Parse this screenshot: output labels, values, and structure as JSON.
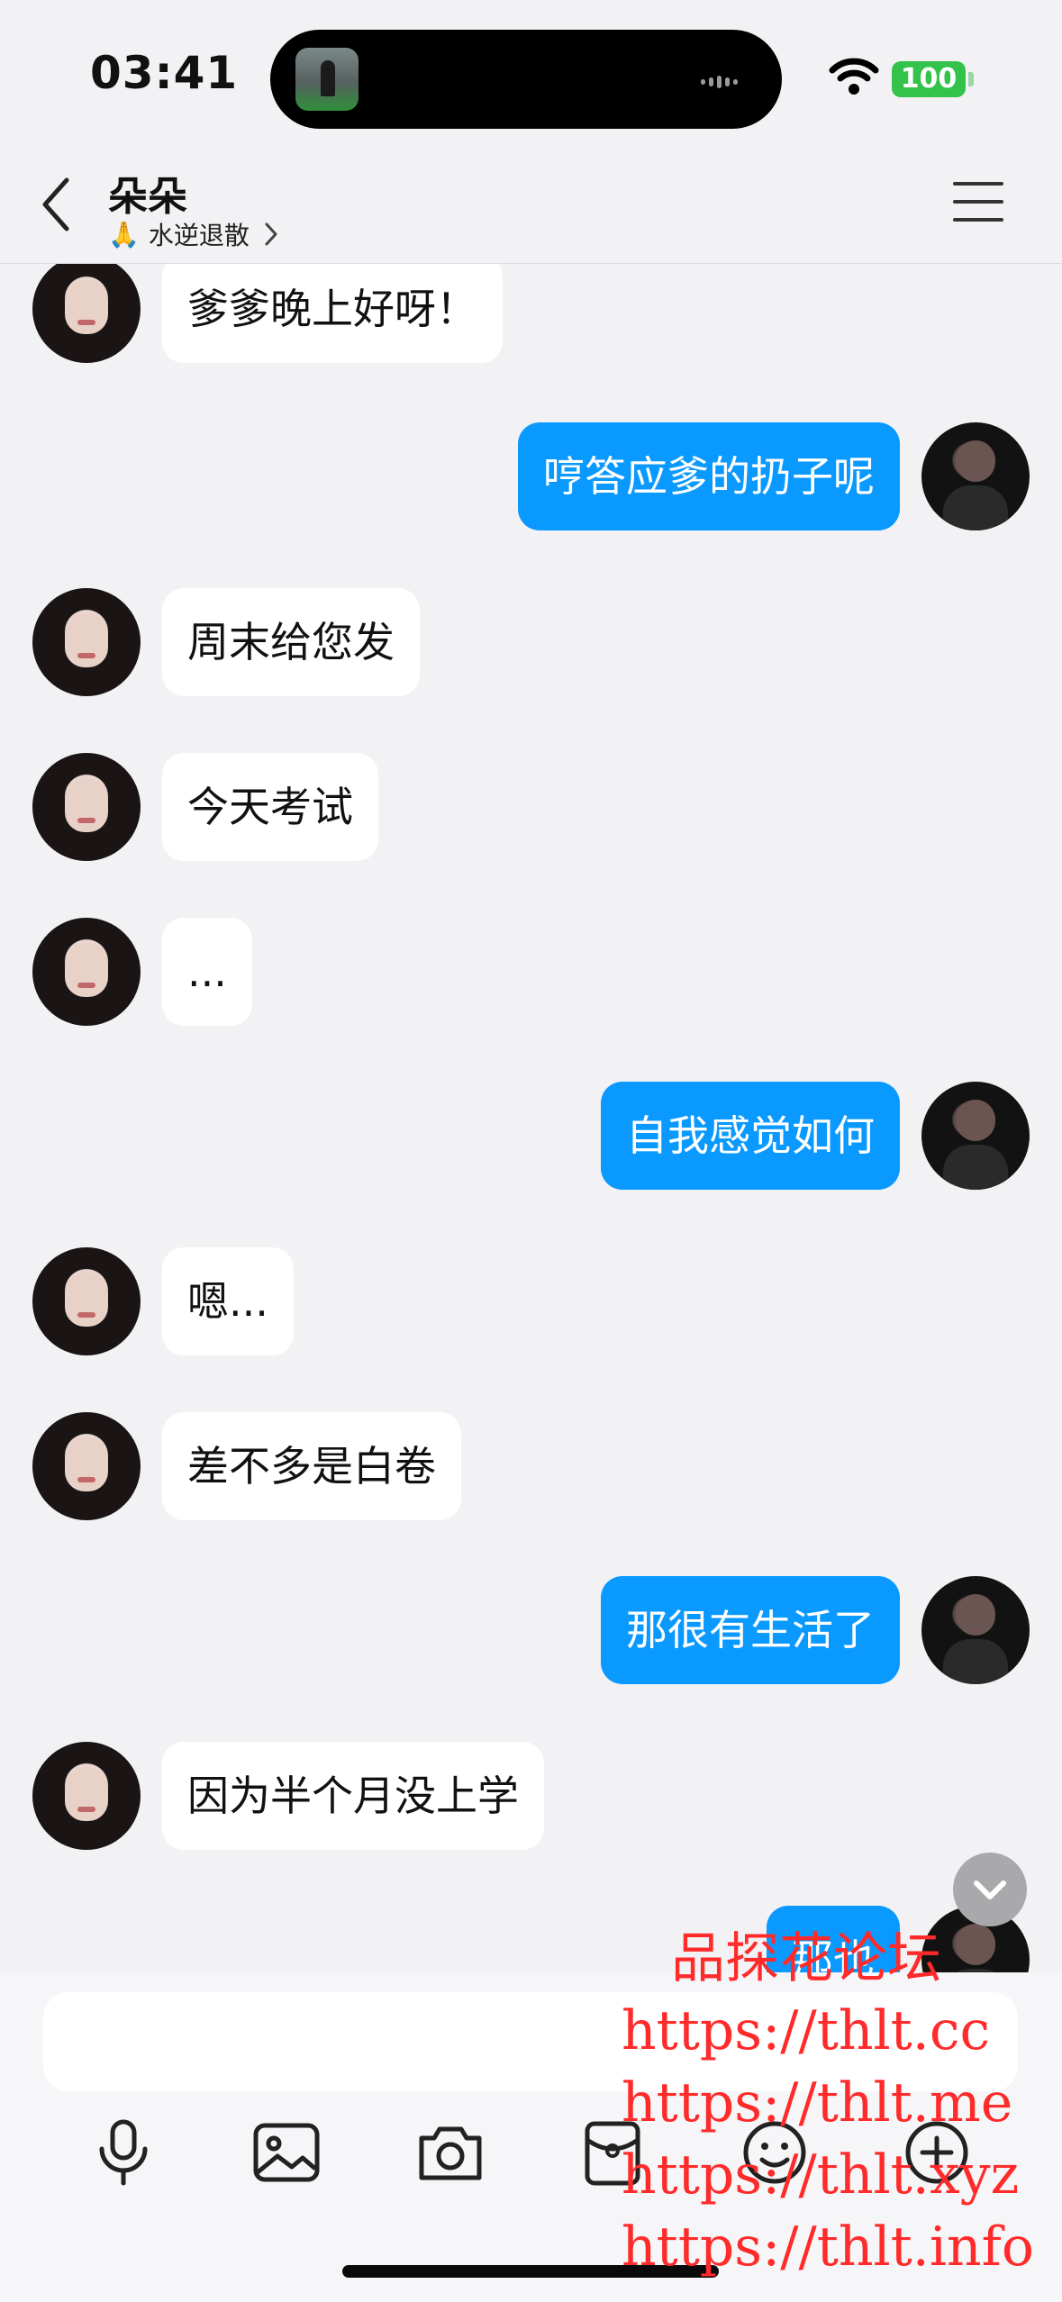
{
  "status_bar": {
    "time": "03:41",
    "battery": "100"
  },
  "header": {
    "title": "朵朵",
    "status_emoji": "🙏",
    "status_text": "水逆退散"
  },
  "messages": [
    {
      "side": "in",
      "text": "爹爹晚上好呀！"
    },
    {
      "side": "out",
      "text": "哼答应爹的扔子呢"
    },
    {
      "side": "in",
      "text": "周末给您发"
    },
    {
      "side": "in",
      "text": "今天考试"
    },
    {
      "side": "in",
      "text": "..."
    },
    {
      "side": "out",
      "text": "自我感觉如何"
    },
    {
      "side": "in",
      "text": "嗯..."
    },
    {
      "side": "in",
      "text": "差不多是白卷"
    },
    {
      "side": "out",
      "text": "那很有生活了"
    },
    {
      "side": "in",
      "text": "因为半个月没上学"
    },
    {
      "side": "out",
      "text": "那也"
    }
  ],
  "composer": {
    "tools": [
      "microphone-icon",
      "image-icon",
      "camera-icon",
      "red-packet-icon",
      "emoji-icon",
      "plus-icon"
    ]
  },
  "watermark": {
    "lines": [
      "品探花论坛",
      "https://thlt.cc",
      "https://thlt.me",
      "https://thlt.xyz",
      "https://thlt.info"
    ]
  },
  "colors": {
    "outgoing_bubble": "#0a99ff",
    "incoming_bubble": "#ffffff",
    "background": "#f2f2f4",
    "battery": "#33c24a",
    "watermark": "#ff2b2b"
  }
}
